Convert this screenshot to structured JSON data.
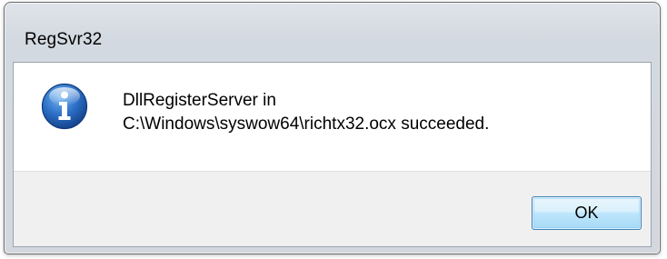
{
  "window": {
    "title": "RegSvr32"
  },
  "dialog": {
    "icon": "information-icon",
    "message_line1": "DllRegisterServer in",
    "message_line2": "C:\\Windows\\syswow64\\richtx32.ocx succeeded.",
    "ok_label": "OK"
  },
  "colors": {
    "icon_blue": "#1f5db3",
    "button_border": "#3c7fb1",
    "footer_bg": "#f0f0f0"
  }
}
